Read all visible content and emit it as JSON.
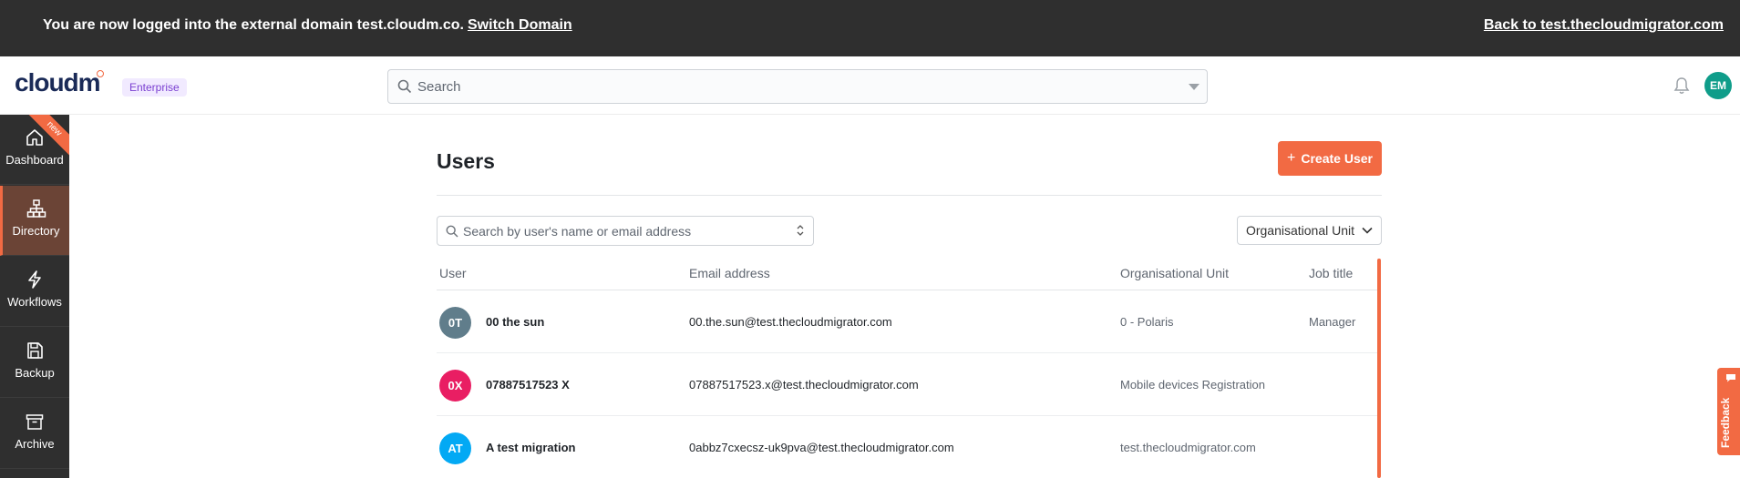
{
  "banner": {
    "message": "You are now logged into the external domain test.cloudm.co.",
    "switch_label": "Switch Domain",
    "back_label": "Back to test.thecloudmigrator.com"
  },
  "header": {
    "logo_text_a": "cloud",
    "logo_text_b": "m",
    "edition_badge": "Enterprise",
    "search_placeholder": "Search",
    "avatar_initials": "EM"
  },
  "sidebar": {
    "items": [
      {
        "label": "Dashboard",
        "icon": "home-icon",
        "ribbon": "new"
      },
      {
        "label": "Directory",
        "icon": "org-chart-icon"
      },
      {
        "label": "Workflows",
        "icon": "lightning-icon"
      },
      {
        "label": "Backup",
        "icon": "save-icon"
      },
      {
        "label": "Archive",
        "icon": "archive-box-icon"
      }
    ],
    "active_index": 1
  },
  "main": {
    "title": "Users",
    "create_button_label": "Create User",
    "user_search_placeholder": "Search by user's name or email address",
    "ou_filter_label": "Organisational Unit",
    "columns": [
      "User",
      "Email address",
      "Organisational Unit",
      "Job title"
    ],
    "rows": [
      {
        "initials": "0T",
        "name": "00 the sun",
        "email": "00.the.sun@test.thecloudmigrator.com",
        "ou": "0 - Polaris",
        "job": "Manager",
        "color": "#607d8b"
      },
      {
        "initials": "0X",
        "name": "07887517523 X",
        "email": "07887517523.x@test.thecloudmigrator.com",
        "ou": "Mobile devices Registration",
        "job": "",
        "color": "#e91e63"
      },
      {
        "initials": "AT",
        "name": "A test migration",
        "email": "0abbz7cxecsz-uk9pva@test.thecloudmigrator.com",
        "ou": "test.thecloudmigrator.com",
        "job": "",
        "color": "#03a9f4"
      }
    ]
  },
  "feedback_label": "Feedback",
  "colors": {
    "accent": "#f26a43",
    "dark": "#2f2f2f",
    "active_nav": "#6b4436"
  }
}
